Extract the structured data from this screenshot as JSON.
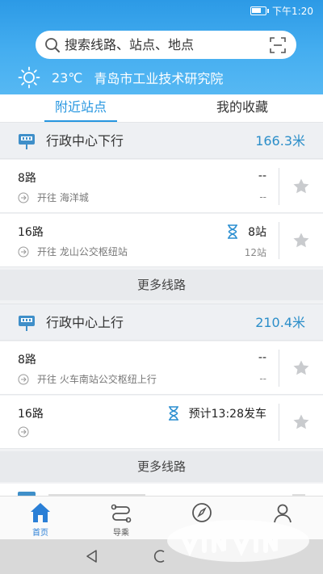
{
  "status_bar": {
    "time": "下午1:20",
    "battery_level": 0.75
  },
  "search": {
    "placeholder": "搜索线路、站点、地点"
  },
  "weather": {
    "temperature": "23℃",
    "location": "青岛市工业技术研究院"
  },
  "tabs": [
    {
      "label": "附近站点",
      "active": true
    },
    {
      "label": "我的收藏",
      "active": false
    }
  ],
  "stations": [
    {
      "name": "行政中心下行",
      "distance": "166.3米",
      "routes": [
        {
          "number": "8路",
          "direction_prefix": "开往",
          "destination": "海洋城",
          "status": "--",
          "sub": "--",
          "hourglass": false
        },
        {
          "number": "16路",
          "direction_prefix": "开往",
          "destination": "龙山公交枢纽站",
          "status": "8站",
          "sub": "12站",
          "hourglass": true
        }
      ],
      "more_label": "更多线路"
    },
    {
      "name": "行政中心上行",
      "distance": "210.4米",
      "routes": [
        {
          "number": "8路",
          "direction_prefix": "开往",
          "destination": "火车南站公交枢纽上行",
          "status": "--",
          "sub": "--",
          "hourglass": false
        },
        {
          "number": "16路",
          "direction_prefix": "",
          "destination": "",
          "status": "预计13:28发车",
          "sub": "",
          "hourglass": true
        }
      ],
      "more_label": "更多线路"
    }
  ],
  "bottom_nav": [
    {
      "label": "首页",
      "icon": "home-icon",
      "active": true
    },
    {
      "label": "导乘",
      "icon": "route-guide-icon",
      "active": false
    },
    {
      "label": "",
      "icon": "compass-icon",
      "active": false
    },
    {
      "label": "",
      "icon": "user-icon",
      "active": false
    }
  ],
  "colors": {
    "accent": "#2696e0",
    "header_top": "#2c9ae6",
    "distance": "#2b8ec9",
    "star": "#c9cbce"
  }
}
